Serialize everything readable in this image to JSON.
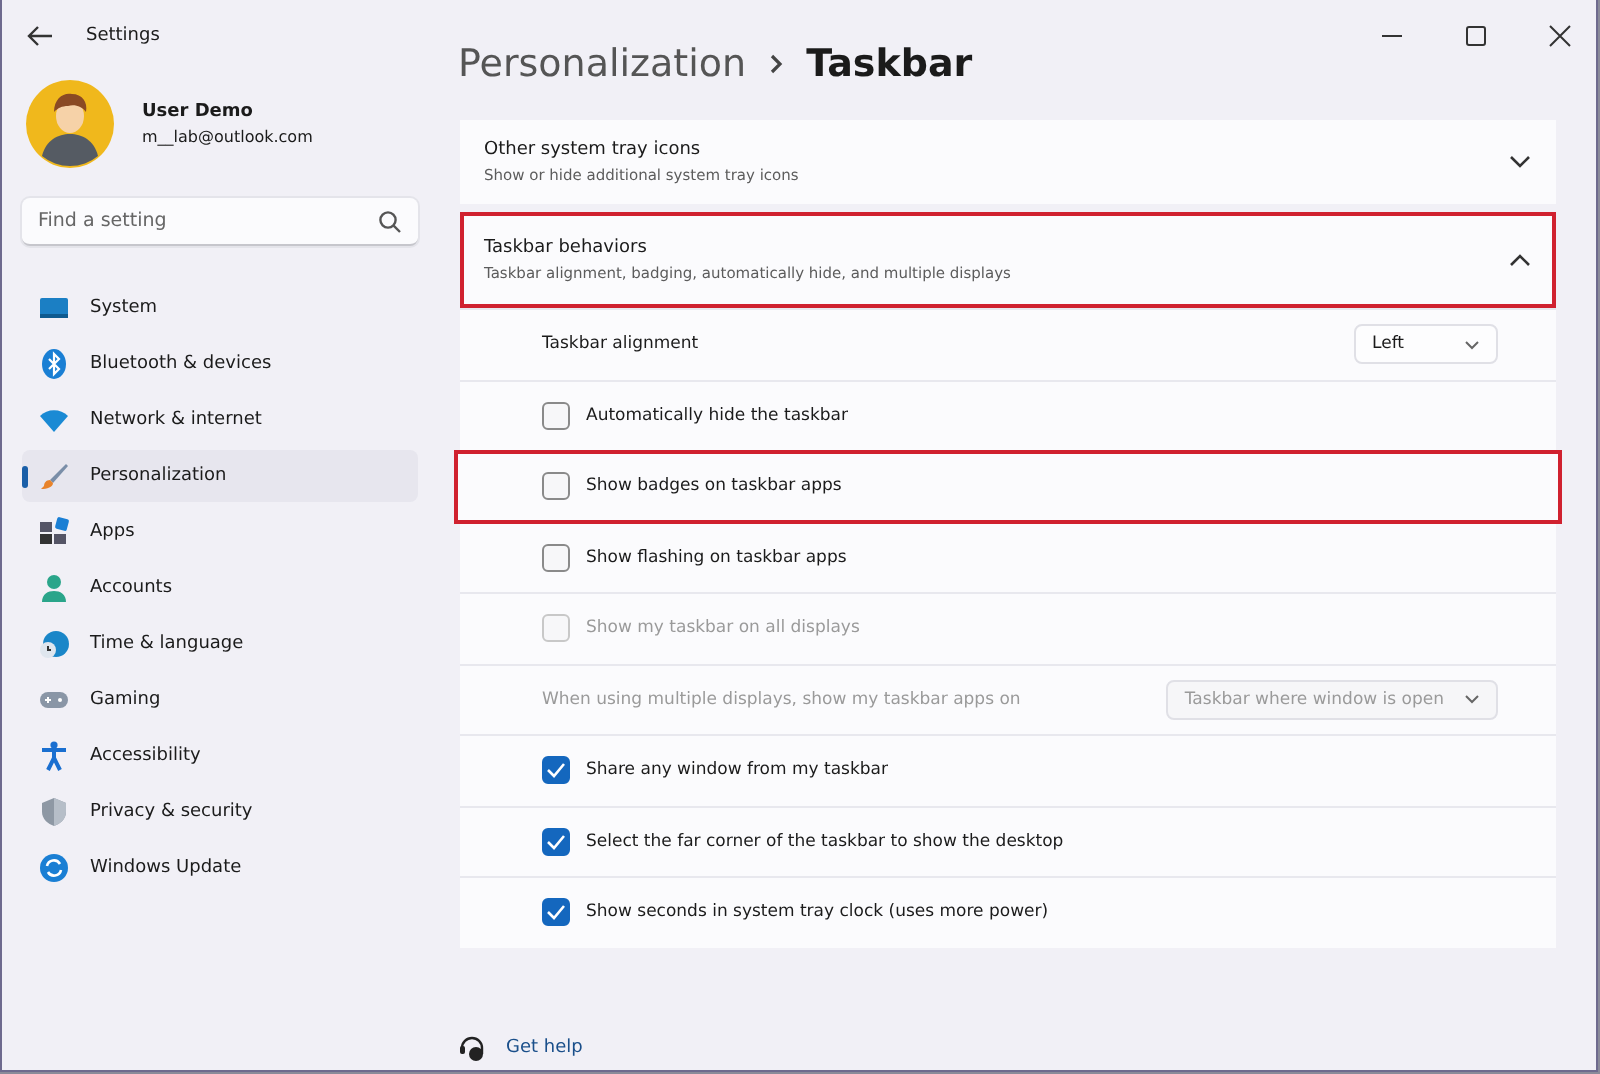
{
  "window": {
    "title": "Settings"
  },
  "user": {
    "name": "User Demo",
    "email": "m__lab@outlook.com"
  },
  "search": {
    "placeholder": "Find a setting"
  },
  "nav": [
    {
      "label": "System",
      "selected": false
    },
    {
      "label": "Bluetooth & devices",
      "selected": false
    },
    {
      "label": "Network & internet",
      "selected": false
    },
    {
      "label": "Personalization",
      "selected": true
    },
    {
      "label": "Apps",
      "selected": false
    },
    {
      "label": "Accounts",
      "selected": false
    },
    {
      "label": "Time & language",
      "selected": false
    },
    {
      "label": "Gaming",
      "selected": false
    },
    {
      "label": "Accessibility",
      "selected": false
    },
    {
      "label": "Privacy & security",
      "selected": false
    },
    {
      "label": "Windows Update",
      "selected": false
    }
  ],
  "breadcrumb": {
    "parent": "Personalization",
    "page": "Taskbar"
  },
  "sections": [
    {
      "title": "Other system tray icons",
      "subtitle": "Show or hide additional system tray icons",
      "expanded": false,
      "highlighted": false
    },
    {
      "title": "Taskbar behaviors",
      "subtitle": "Taskbar alignment, badging, automatically hide, and multiple displays",
      "expanded": true,
      "highlighted": true,
      "settings": [
        {
          "kind": "dropdown",
          "label": "Taskbar alignment",
          "value": "Left",
          "disabled": false,
          "highlighted": false
        },
        {
          "kind": "checkbox",
          "label": "Automatically hide the taskbar",
          "checked": false,
          "disabled": false,
          "highlighted": false
        },
        {
          "kind": "checkbox",
          "label": "Show badges on taskbar apps",
          "checked": false,
          "disabled": false,
          "highlighted": true
        },
        {
          "kind": "checkbox",
          "label": "Show flashing on taskbar apps",
          "checked": false,
          "disabled": false,
          "highlighted": false
        },
        {
          "kind": "checkbox",
          "label": "Show my taskbar on all displays",
          "checked": false,
          "disabled": true,
          "highlighted": false
        },
        {
          "kind": "dropdown",
          "label": "When using multiple displays, show my taskbar apps on",
          "value": "Taskbar where window is open",
          "disabled": true,
          "highlighted": false
        },
        {
          "kind": "checkbox",
          "label": "Share any window from my taskbar",
          "checked": true,
          "disabled": false,
          "highlighted": false
        },
        {
          "kind": "checkbox",
          "label": "Select the far corner of the taskbar to show the desktop",
          "checked": true,
          "disabled": false,
          "highlighted": false
        },
        {
          "kind": "checkbox",
          "label": "Show seconds in system tray clock (uses more power)",
          "checked": true,
          "disabled": false,
          "highlighted": false
        }
      ]
    }
  ],
  "help_link": "Get help"
}
